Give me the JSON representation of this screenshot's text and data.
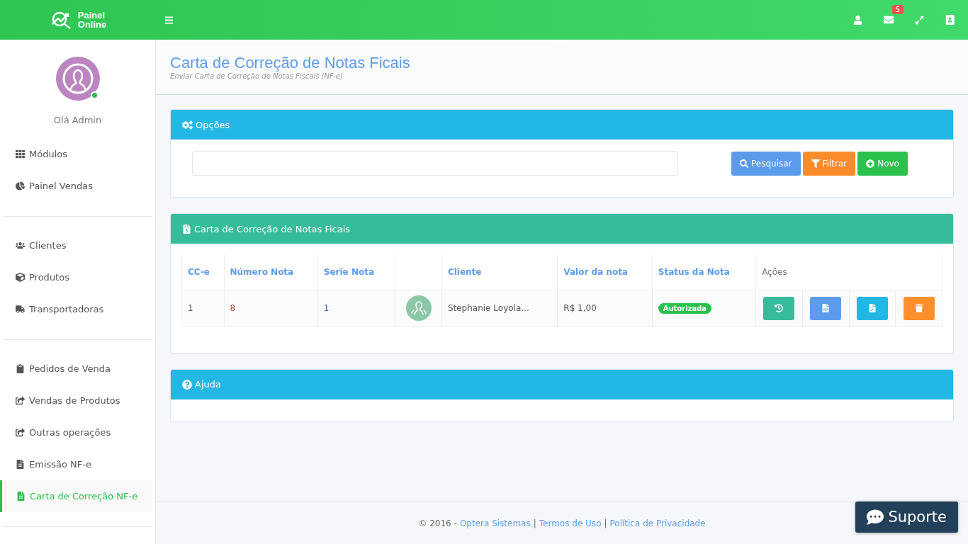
{
  "header": {
    "logo_lines": [
      "Painel",
      "Online"
    ],
    "mail_badge": "5"
  },
  "sidebar": {
    "greeting": "Olá Admin",
    "online": true,
    "groups": [
      [
        {
          "label": "Módulos",
          "kind": "grid",
          "selected": false
        },
        {
          "label": "Painel Vendas",
          "kind": "pie",
          "selected": false
        }
      ],
      [
        {
          "label": "Clientes",
          "kind": "users",
          "selected": false
        },
        {
          "label": "Produtos",
          "kind": "cube",
          "selected": false
        },
        {
          "label": "Transportadoras",
          "kind": "truck",
          "selected": false
        }
      ],
      [
        {
          "label": "Pedidos de Venda",
          "kind": "clipboard",
          "selected": false
        },
        {
          "label": "Vendas de Produtos",
          "kind": "share",
          "selected": false
        },
        {
          "label": "Outras operações",
          "kind": "share",
          "selected": false
        },
        {
          "label": "Emissão NF-e",
          "kind": "file",
          "selected": false
        },
        {
          "label": "Carta de Correção NF-e",
          "kind": "file",
          "selected": true
        }
      ]
    ]
  },
  "page": {
    "title": "Carta de Correção de Notas Ficais",
    "subtitle": "Enviar Carta de Correção de Notas Fiscais (NF-e)"
  },
  "options_panel": {
    "title": "Opções",
    "buttons": [
      {
        "label": "Pesquisar",
        "kind": "search",
        "color": "#5b9bea"
      },
      {
        "label": "Filtrar",
        "kind": "filter",
        "color": "#fb8c2c"
      },
      {
        "label": "Novo",
        "kind": "new",
        "color": "#2bc14c"
      }
    ]
  },
  "table_panel": {
    "title": "Carta de Correção de Notas Ficais",
    "table": {
      "columns": [
        "CC-e",
        "Número Nota",
        "Serie Nota",
        "",
        "Cliente",
        "Valor da nota",
        "Status da Nota",
        "Ações"
      ],
      "rows": [
        {
          "cce": "1",
          "numero": "8",
          "serie": "1",
          "cliente": "Stephanie Loyola...",
          "valor": "R$ 1,00",
          "status": "Autorizada",
          "actions": [
            {
              "kind": "history",
              "color": "#37bc9b"
            },
            {
              "kind": "code",
              "color": "#5d9cec"
            },
            {
              "kind": "pdf",
              "color": "#23b7e5"
            },
            {
              "kind": "delete",
              "color": "#fd8f2c"
            }
          ]
        }
      ]
    }
  },
  "help_panel": {
    "title": "Ajuda"
  },
  "footer": [
    {
      "kind": "text",
      "text": "© 2016 -"
    },
    {
      "kind": "link",
      "text": "Optera Sistemas"
    },
    {
      "kind": "text",
      "text": "|"
    },
    {
      "kind": "link",
      "text": "Termos de Uso"
    },
    {
      "kind": "text",
      "text": "|"
    },
    {
      "kind": "link",
      "text": "Política de Privacidade"
    }
  ],
  "support_button": {
    "label": "Suporte"
  }
}
